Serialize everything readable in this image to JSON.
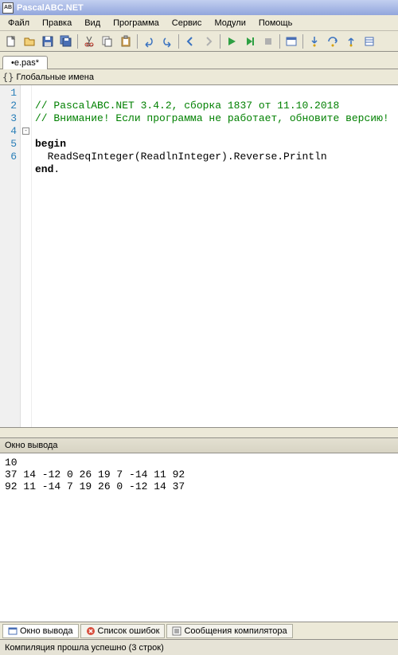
{
  "title": "PascalABC.NET",
  "menu": [
    "Файл",
    "Правка",
    "Вид",
    "Программа",
    "Сервис",
    "Модули",
    "Помощь"
  ],
  "tab": "•e.pas*",
  "scope": "Глобальные имена",
  "code": {
    "lines": [
      "1",
      "2",
      "3",
      "4",
      "5",
      "6"
    ],
    "l1": "// PascalABC.NET 3.4.2, сборка 1837 от 11.10.2018",
    "l2": "// Внимание! Если программа не работает, обновите версию!",
    "l4a": "begin",
    "l5": "ReadSeqInteger(ReadlnInteger).Reverse.Println",
    "l6a": "end",
    "l6b": "."
  },
  "output": {
    "title": "Окно вывода",
    "text": "10\n37 14 -12 0 26 19 7 -14 11 92\n92 11 -14 7 19 26 0 -12 14 37"
  },
  "bottomTabs": {
    "t1": "Окно вывода",
    "t2": "Список ошибок",
    "t3": "Сообщения компилятора"
  },
  "status": "Компиляция прошла успешно (3 строк)"
}
